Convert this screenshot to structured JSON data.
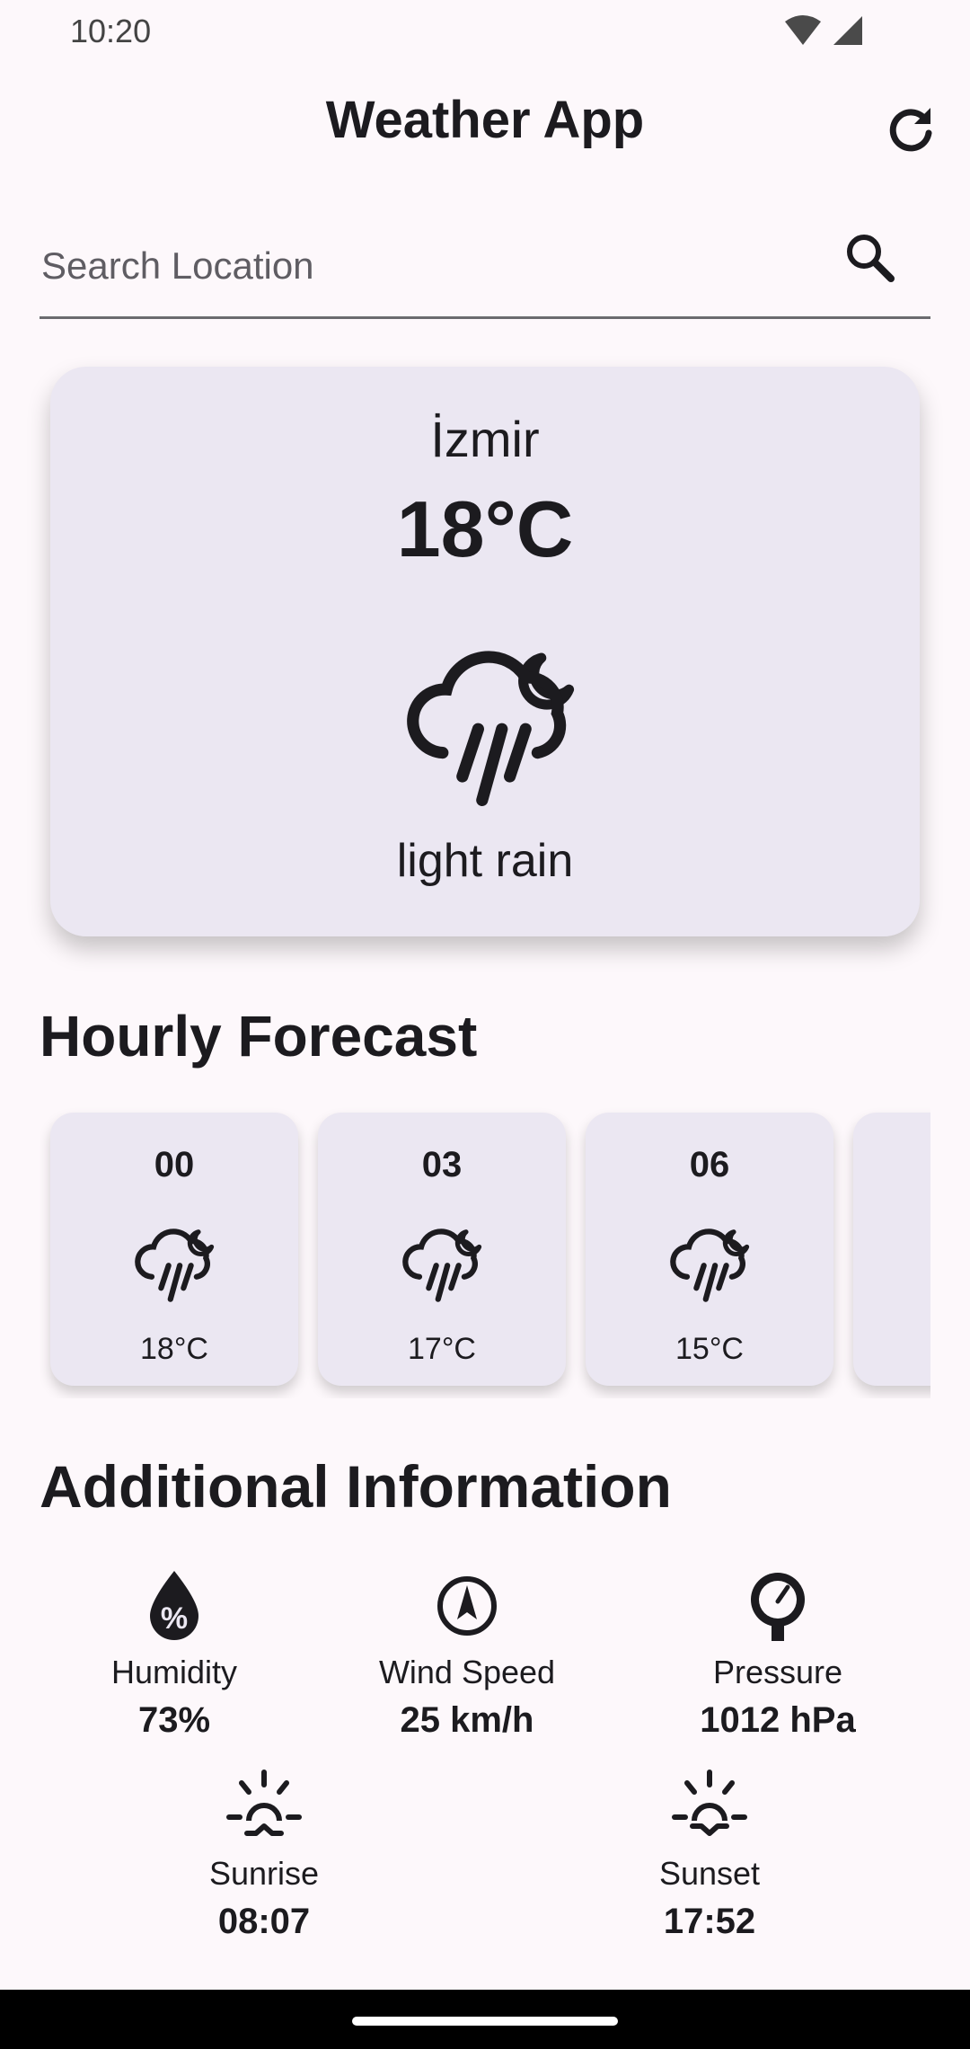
{
  "status_bar": {
    "time": "10:20"
  },
  "app_bar": {
    "title": "Weather App"
  },
  "search": {
    "placeholder": "Search Location",
    "value": ""
  },
  "current": {
    "city": "İzmir",
    "temperature": "18°C",
    "condition": "light rain",
    "icon": "rain-night-icon"
  },
  "hourly": {
    "title": "Hourly Forecast",
    "items": [
      {
        "hour": "00",
        "temperature": "18°C",
        "icon": "rain-night-icon"
      },
      {
        "hour": "03",
        "temperature": "17°C",
        "icon": "rain-night-icon"
      },
      {
        "hour": "06",
        "temperature": "15°C",
        "icon": "rain-night-icon"
      }
    ]
  },
  "additional": {
    "title": "Additional Information",
    "humidity": {
      "label": "Humidity",
      "value": "73%"
    },
    "wind": {
      "label": "Wind Speed",
      "value": "25 km/h"
    },
    "pressure": {
      "label": "Pressure",
      "value": "1012 hPa"
    },
    "sunrise": {
      "label": "Sunrise",
      "value": "08:07"
    },
    "sunset": {
      "label": "Sunset",
      "value": "17:52"
    }
  },
  "colors": {
    "background": "#fdf8fb",
    "card": "#ebe7f2",
    "text": "#1c1b1f"
  }
}
